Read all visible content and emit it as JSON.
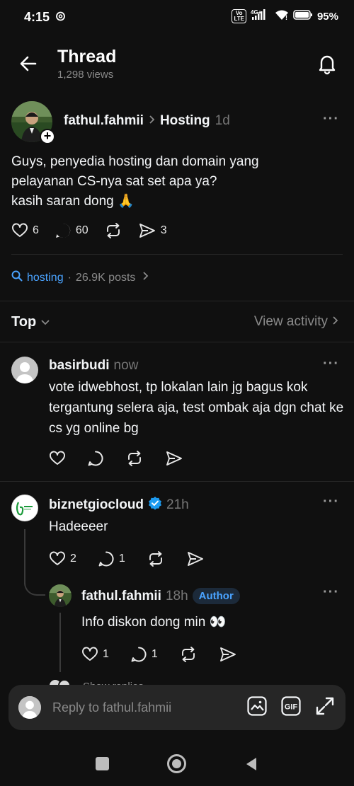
{
  "status_bar": {
    "time": "4:15",
    "threads_glyph": "@",
    "volte": "Vo LTE",
    "network": "4G+",
    "battery": "95%"
  },
  "header": {
    "title": "Thread",
    "views": "1,298 views"
  },
  "post": {
    "author": "fathul.fahmii",
    "separator": ">",
    "topic": "Hosting",
    "time": "1d",
    "more": "···",
    "text_lines": [
      "Guys, penyedia hosting dan domain yang",
      "pelayanan CS-nya sat set apa ya?",
      "kasih saran dong 🙏"
    ],
    "likes": "6",
    "replies": "60",
    "shares": "3"
  },
  "topic_tag": {
    "name": "hosting",
    "dot": "·",
    "posts": "26.9K posts",
    "chevron": ">"
  },
  "sort": {
    "label": "Top",
    "view_activity": "View activity"
  },
  "replies": [
    {
      "author": "basirbudi",
      "time": "now",
      "text": "vote idwebhost, tp lokalan lain jg bagus kok tergantung selera aja, test ombak aja dgn chat ke cs yg online bg"
    },
    {
      "author": "biznetgiocloud",
      "time": "21h",
      "text": "Hadeeeer",
      "likes": "2",
      "replies": "1"
    },
    {
      "author": "fathul.fahmii",
      "time": "18h",
      "badge": "Author",
      "text": "Info diskon dong min 👀",
      "likes": "1",
      "replies": "1"
    }
  ],
  "show_replies": "Show replies",
  "composer": {
    "placeholder": "Reply to fathul.fahmii",
    "gif_label": "GIF"
  },
  "colors": {
    "background": "#101010",
    "accent_link": "#4aa3ff",
    "muted": "#8a8a8a",
    "verified": "#1d9bf0"
  }
}
